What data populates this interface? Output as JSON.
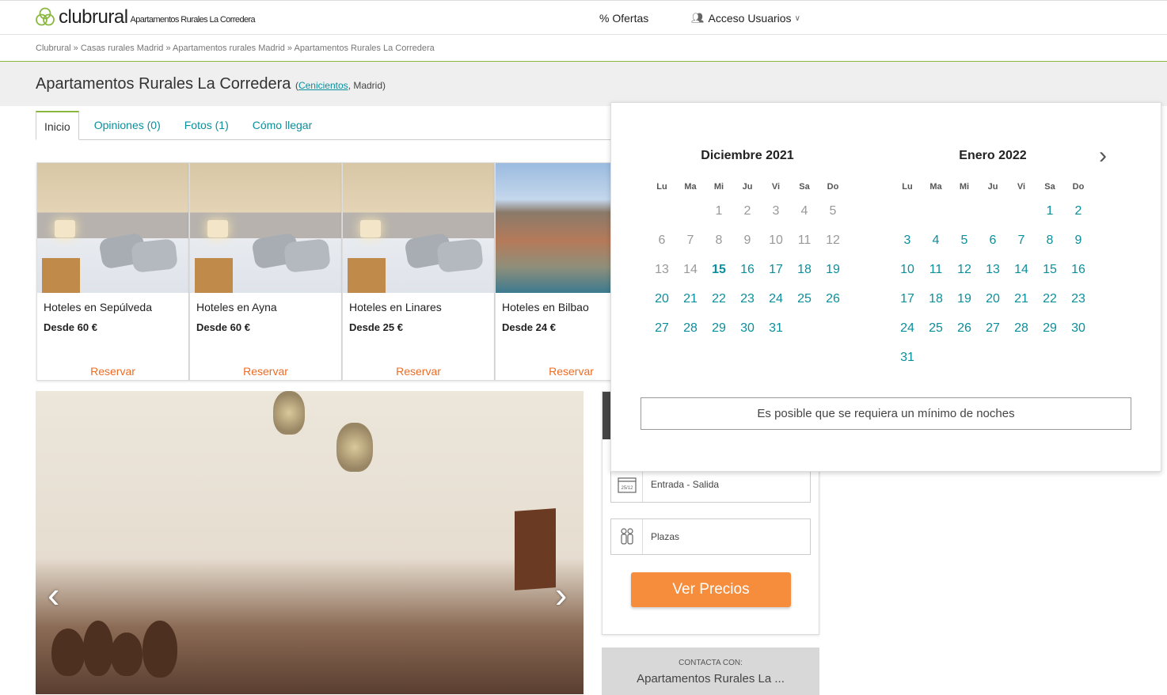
{
  "header": {
    "logo_text": "clubrural",
    "logo_subtitle": "Apartamentos Rurales La Corredera",
    "ofertas_label": "% Ofertas",
    "acceso_label": "Acceso Usuarios"
  },
  "breadcrumb": "Clubrural » Casas rurales Madrid » Apartamentos rurales Madrid » Apartamentos Rurales La Corredera",
  "title": {
    "name": "Apartamentos Rurales La Corredera",
    "location_link": "Cenicientos",
    "location_rest": ", Madrid)",
    "location_open": "("
  },
  "tabs": [
    "Inicio",
    "Opiniones (0)",
    "Fotos (1)",
    "Cómo llegar"
  ],
  "cards": [
    {
      "title": "Hoteles en Sepúlveda",
      "price": "Desde 60 €",
      "button": "Reservar"
    },
    {
      "title": "Hoteles en Ayna",
      "price": "Desde 60 €",
      "button": "Reservar"
    },
    {
      "title": "Hoteles en Linares",
      "price": "Desde 25 €",
      "button": "Reservar"
    },
    {
      "title": "Hoteles en Bilbao",
      "price": "Desde 24 €",
      "button": "Reservar"
    }
  ],
  "booking": {
    "date_icon_text": "25/12",
    "dates_label": "Entrada - Salida",
    "guests_label": "Plazas",
    "submit_label": "Ver Precios"
  },
  "contact": {
    "label": "CONTACTA CON:",
    "name": "Apartamentos Rurales La ..."
  },
  "calendar": {
    "weekdays": [
      "Lu",
      "Ma",
      "Mi",
      "Ju",
      "Vi",
      "Sa",
      "Do"
    ],
    "months": [
      {
        "title": "Diciembre 2021",
        "offset": 2,
        "days": 31,
        "past_until": 14,
        "today": 15
      },
      {
        "title": "Enero 2022",
        "offset": 5,
        "days": 31,
        "past_until": 0,
        "today": 0
      }
    ],
    "note": "Es posible que se requiera un mínimo de noches"
  },
  "colors": {
    "accent": "#0a8f9c",
    "brand_green": "#8ab73d",
    "cta_orange": "#f58d3c",
    "reserve_orange": "#ee6b22"
  }
}
